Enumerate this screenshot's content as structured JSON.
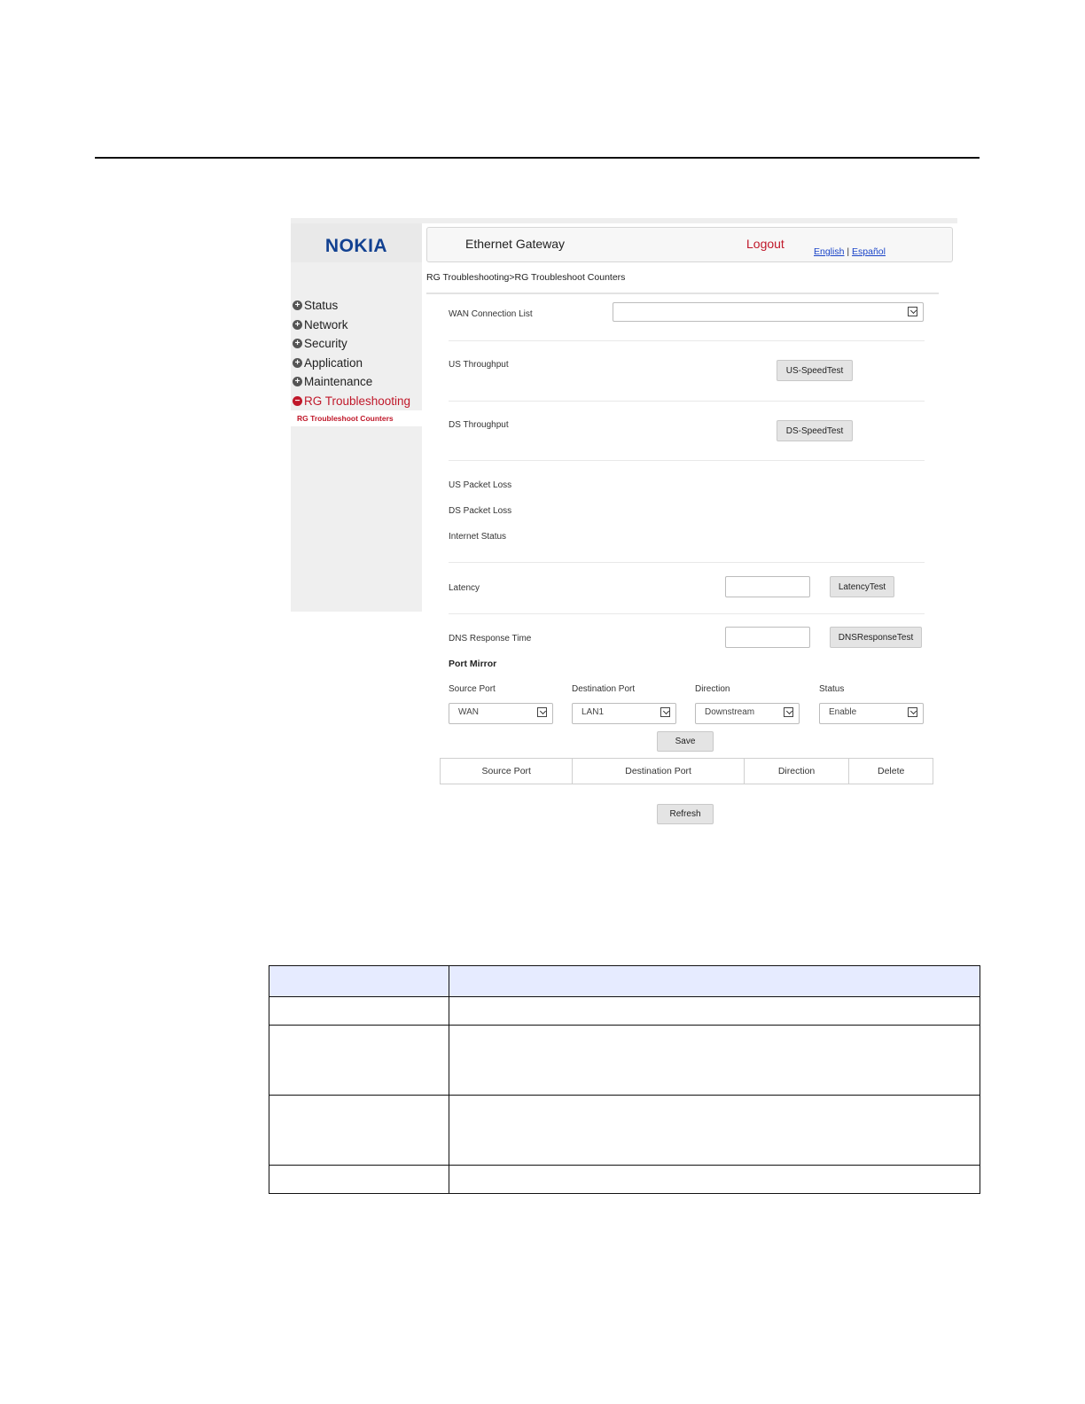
{
  "header": {
    "logo": "NOKIA",
    "title": "Ethernet Gateway",
    "logout": "Logout",
    "lang_english": "English",
    "lang_sep": "|",
    "lang_espanol": "Español"
  },
  "sidebar": {
    "items": [
      {
        "label": "Status"
      },
      {
        "label": "Network"
      },
      {
        "label": "Security"
      },
      {
        "label": "Application"
      },
      {
        "label": "Maintenance"
      },
      {
        "label": "RG Troubleshooting"
      }
    ],
    "sub_item": "RG Troubleshoot Counters"
  },
  "breadcrumb": "RG Troubleshooting>RG Troubleshoot Counters",
  "form": {
    "wan_connection_list": "WAN Connection List",
    "us_throughput": "US Throughput",
    "us_speedtest": "US-SpeedTest",
    "ds_throughput": "DS Throughput",
    "ds_speedtest": "DS-SpeedTest",
    "us_packet_loss": "US Packet Loss",
    "ds_packet_loss": "DS Packet Loss",
    "internet_status": "Internet Status",
    "latency": "Latency",
    "latency_test": "LatencyTest",
    "dns_response_time": "DNS Response Time",
    "dns_response_test": "DNSResponseTest"
  },
  "port_mirror": {
    "title": "Port Mirror",
    "source_port_label": "Source Port",
    "destination_port_label": "Destination Port",
    "direction_label": "Direction",
    "status_label": "Status",
    "source_port_value": "WAN",
    "destination_port_value": "LAN1",
    "direction_value": "Downstream",
    "status_value": "Enable",
    "save": "Save",
    "table_headers": [
      "Source Port",
      "Destination Port",
      "Direction",
      "Delete"
    ],
    "refresh": "Refresh"
  },
  "doc_table": {
    "rows": 5
  }
}
